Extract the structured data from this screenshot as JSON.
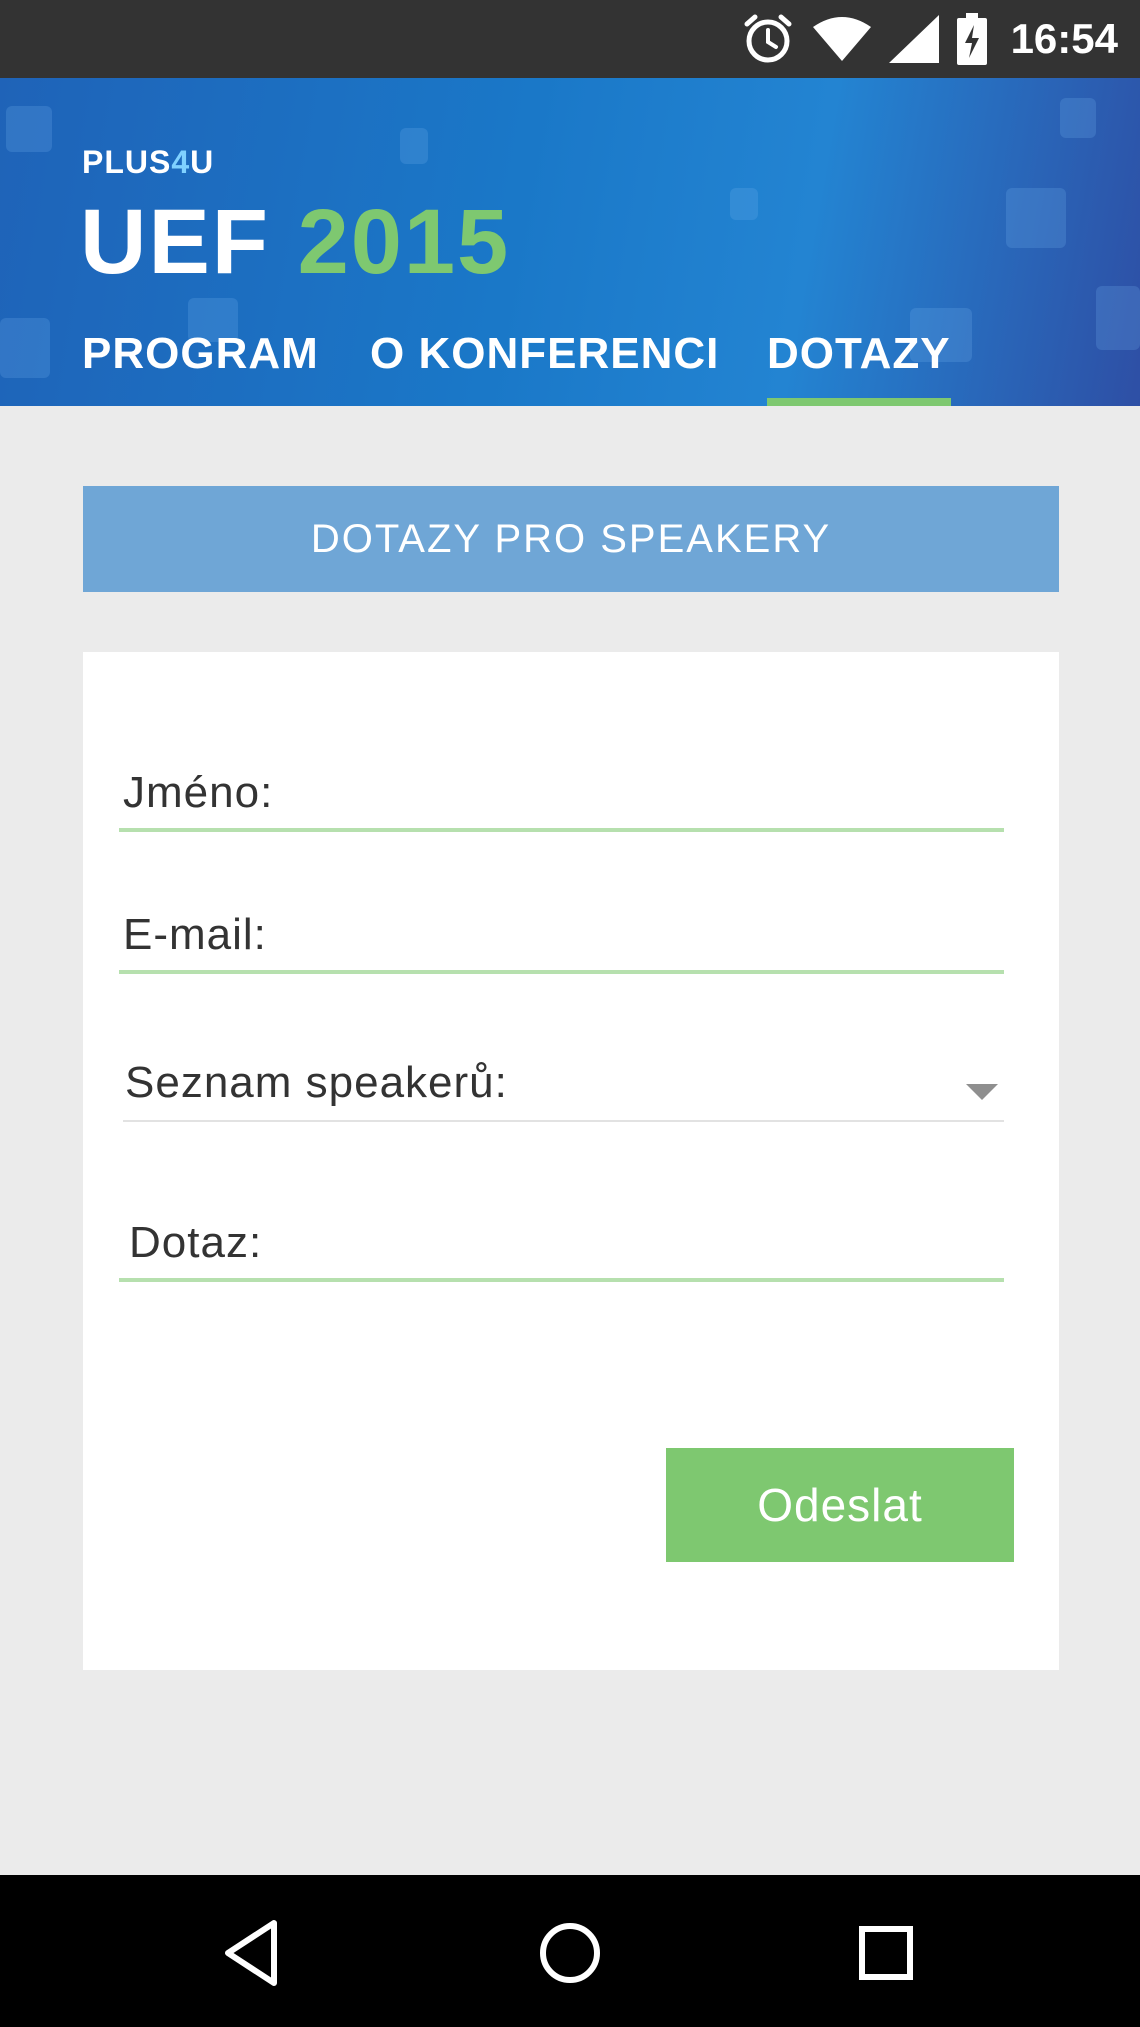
{
  "status_bar": {
    "time": "16:54",
    "icons": [
      "alarm-icon",
      "wifi-icon",
      "signal-icon",
      "battery-charging-icon"
    ]
  },
  "header": {
    "brand": {
      "text": "PLUS",
      "highlight": "4",
      "suffix": "U"
    },
    "title": {
      "main": "UEF",
      "year": "2015"
    },
    "tabs": [
      {
        "label": "PROGRAM",
        "active": false
      },
      {
        "label": "O KONFERENCI",
        "active": false
      },
      {
        "label": "DOTAZY",
        "active": true
      }
    ]
  },
  "section": {
    "title": "DOTAZY PRO SPEAKERY"
  },
  "form": {
    "name_label": "Jméno:",
    "email_label": "E-mail:",
    "speakers_label": "Seznam speakerů:",
    "question_label": "Dotaz:",
    "submit_label": "Odeslat"
  },
  "navbar": {
    "icons": [
      "back-icon",
      "home-icon",
      "recents-icon"
    ]
  },
  "colors": {
    "header_blue": "#1a78c8",
    "accent_green": "#7ec870",
    "banner_blue": "#6fa6d6",
    "field_underline": "#b6e0ae",
    "status_bar": "#333333"
  }
}
